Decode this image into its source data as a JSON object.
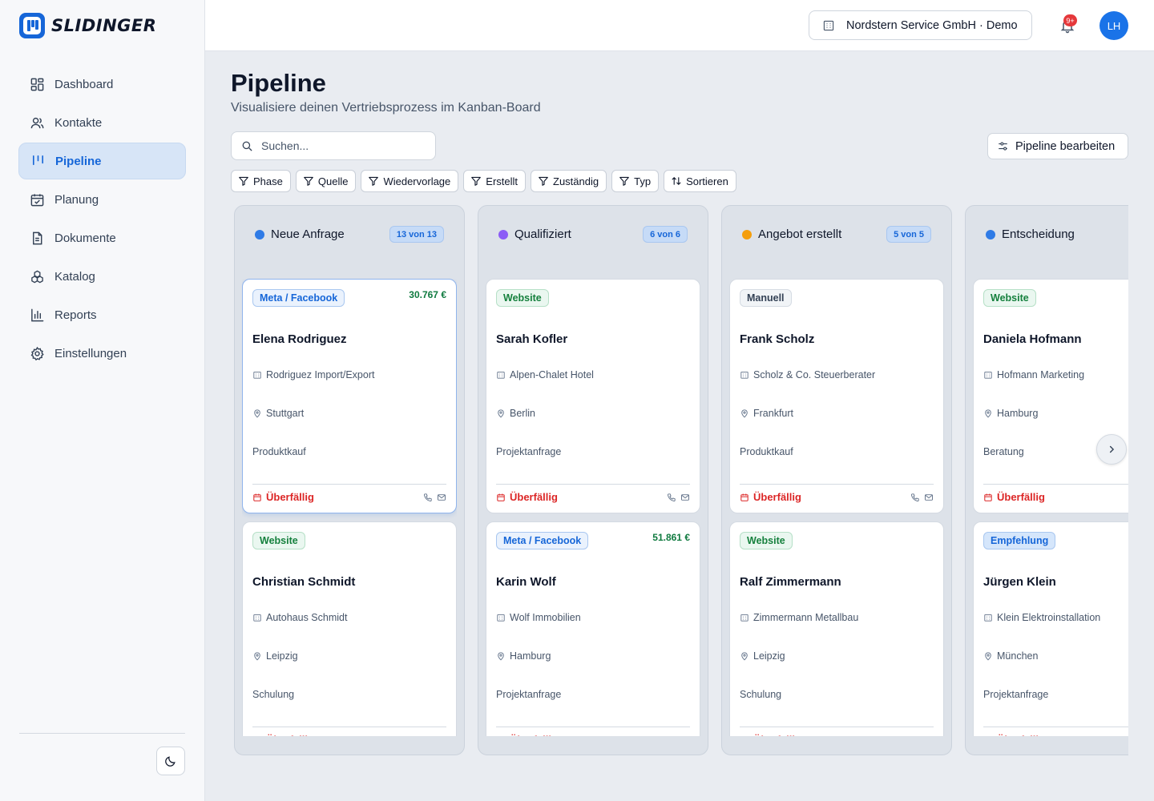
{
  "brand": {
    "name": "SLIDINGER"
  },
  "sidebar": {
    "items": [
      {
        "label": "Dashboard",
        "icon": "dashboard-icon"
      },
      {
        "label": "Kontakte",
        "icon": "contacts-icon"
      },
      {
        "label": "Pipeline",
        "icon": "pipeline-icon",
        "active": true
      },
      {
        "label": "Planung",
        "icon": "calendar-icon"
      },
      {
        "label": "Dokumente",
        "icon": "document-icon"
      },
      {
        "label": "Katalog",
        "icon": "catalog-icon"
      },
      {
        "label": "Reports",
        "icon": "reports-icon"
      },
      {
        "label": "Einstellungen",
        "icon": "settings-icon"
      }
    ]
  },
  "topbar": {
    "tenant": "Nordstern Service GmbH · Demo",
    "notifications_badge": "9+",
    "avatar_initials": "LH"
  },
  "header": {
    "title": "Pipeline",
    "subtitle": "Visualisiere deinen Vertriebsprozess im Kanban-Board"
  },
  "search": {
    "placeholder": "Suchen..."
  },
  "edit_pipeline_label": "Pipeline bearbeiten",
  "filters": [
    "Phase",
    "Quelle",
    "Wiedervorlage",
    "Erstellt",
    "Zuständig",
    "Typ"
  ],
  "sort_label": "Sortieren",
  "colors": {
    "accent": "#1666d8",
    "overdue": "#dc2626",
    "amount": "#0f7a3f"
  },
  "columns": [
    {
      "title": "Neue Anfrage",
      "dot_color": "#2f7be6",
      "count": "13 von 13",
      "cards": [
        {
          "source": "Meta / Facebook",
          "source_type": "meta",
          "amount": "30.767 €",
          "name": "Elena Rodriguez",
          "company": "Rodriguez Import/Export",
          "city": "Stuttgart",
          "type": "Produktkauf",
          "status": "Überfällig",
          "selected": true
        },
        {
          "source": "Website",
          "source_type": "web",
          "amount": "",
          "name": "Christian Schmidt",
          "company": "Autohaus Schmidt",
          "city": "Leipzig",
          "type": "Schulung",
          "status": "Überfällig"
        }
      ]
    },
    {
      "title": "Qualifiziert",
      "dot_color": "#8b5cf6",
      "count": "6 von 6",
      "cards": [
        {
          "source": "Website",
          "source_type": "web",
          "amount": "",
          "name": "Sarah Kofler",
          "company": "Alpen-Chalet Hotel",
          "city": "Berlin",
          "type": "Projektanfrage",
          "status": "Überfällig"
        },
        {
          "source": "Meta / Facebook",
          "source_type": "meta",
          "amount": "51.861 €",
          "name": "Karin Wolf",
          "company": "Wolf Immobilien",
          "city": "Hamburg",
          "type": "Projektanfrage",
          "status": "Überfällig"
        }
      ]
    },
    {
      "title": "Angebot erstellt",
      "dot_color": "#f59e0b",
      "count": "5 von 5",
      "cards": [
        {
          "source": "Manuell",
          "source_type": "man",
          "amount": "",
          "name": "Frank Scholz",
          "company": "Scholz & Co. Steuerberater",
          "city": "Frankfurt",
          "type": "Produktkauf",
          "status": "Überfällig"
        },
        {
          "source": "Website",
          "source_type": "web",
          "amount": "",
          "name": "Ralf Zimmermann",
          "company": "Zimmermann Metallbau",
          "city": "Leipzig",
          "type": "Schulung",
          "status": "Überfällig"
        }
      ]
    },
    {
      "title": "Entscheidung",
      "dot_color": "#2f7be6",
      "count": "",
      "cards": [
        {
          "source": "Website",
          "source_type": "web",
          "amount": "",
          "name": "Daniela Hofmann",
          "company": "Hofmann Marketing",
          "city": "Hamburg",
          "type": "Beratung",
          "status": "Überfällig"
        },
        {
          "source": "Empfehlung",
          "source_type": "empf",
          "amount": "",
          "name": "Jürgen Klein",
          "company": "Klein Elektroinstallation",
          "city": "München",
          "type": "Projektanfrage",
          "status": "Überfällig"
        }
      ]
    }
  ]
}
